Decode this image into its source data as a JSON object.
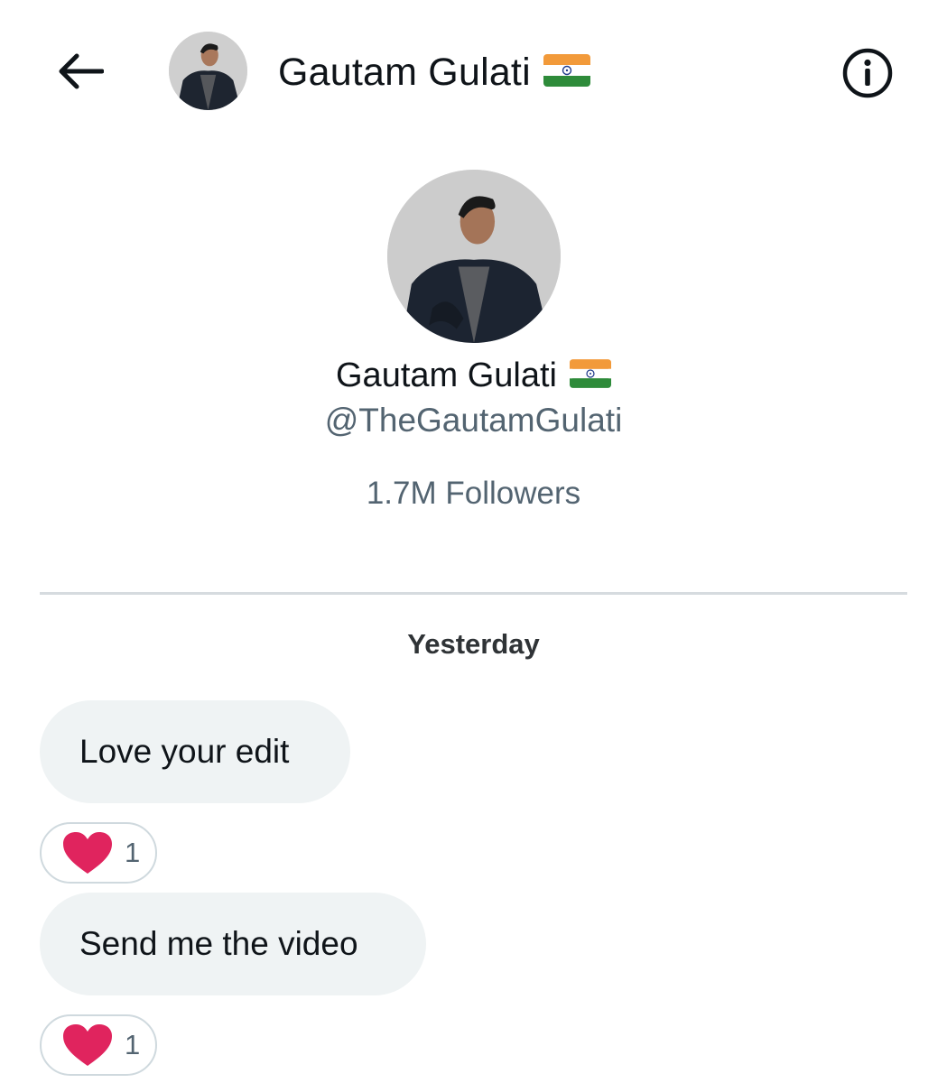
{
  "header": {
    "back_icon": "arrow-left-icon",
    "name": "Gautam Gulati",
    "flag_icon": "india-flag-icon",
    "info_icon": "info-circle-icon"
  },
  "profile": {
    "name": "Gautam Gulati",
    "flag_icon": "india-flag-icon",
    "handle": "@TheGautamGulati",
    "followers": "1.7M Followers"
  },
  "conversation": {
    "date_separator": "Yesterday",
    "messages": [
      {
        "text": "Love your edit",
        "reaction_icon": "heart-icon",
        "reaction_count": "1"
      },
      {
        "text": "Send me the video",
        "reaction_icon": "heart-icon",
        "reaction_count": "1"
      }
    ]
  },
  "colors": {
    "text_primary": "#0f1419",
    "text_secondary": "#536471",
    "bubble_bg": "#eff3f4",
    "heart": "#e0245e",
    "divider": "#d6dbdf"
  }
}
